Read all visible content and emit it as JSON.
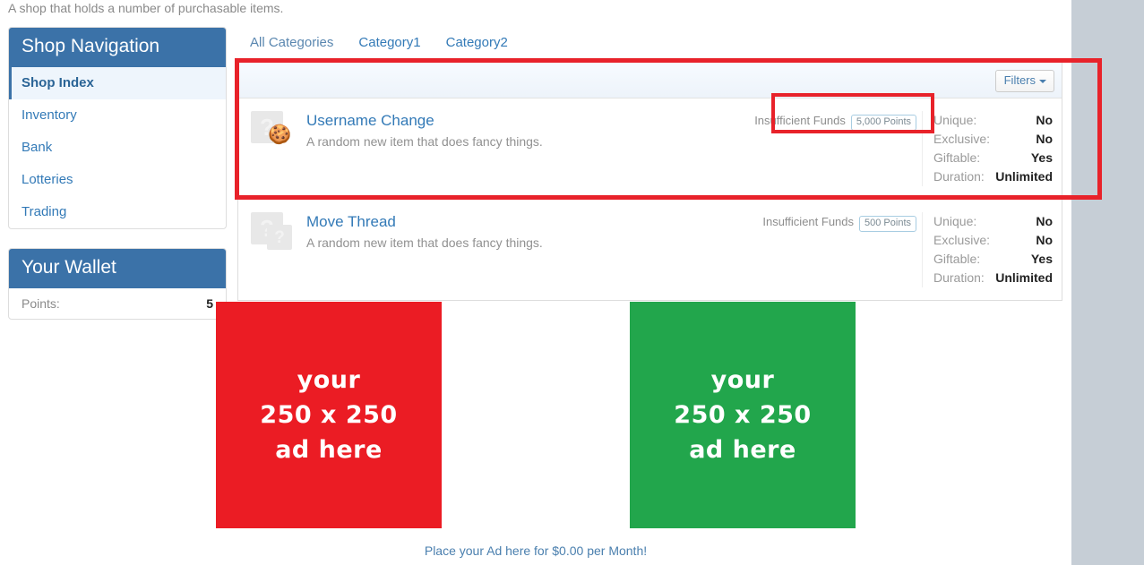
{
  "intro": "A shop that holds a number of purchasable items.",
  "sidebar": {
    "nav": {
      "title": "Shop Navigation",
      "items": [
        {
          "label": "Shop Index",
          "active": true
        },
        {
          "label": "Inventory",
          "active": false
        },
        {
          "label": "Bank",
          "active": false
        },
        {
          "label": "Lotteries",
          "active": false
        },
        {
          "label": "Trading",
          "active": false
        }
      ]
    },
    "wallet": {
      "title": "Your Wallet",
      "points_label": "Points:",
      "points_value": "5"
    }
  },
  "main": {
    "tabs": [
      {
        "label": "All Categories",
        "active": true
      },
      {
        "label": "Category1",
        "active": false
      },
      {
        "label": "Category2",
        "active": false
      }
    ],
    "toolbar": {
      "filters_label": "Filters"
    },
    "items": [
      {
        "title": "Username Change",
        "description": "A random new item that does fancy things.",
        "buy_status": "Insufficient Funds",
        "price_badge": "5,000 Points",
        "thumb_glyph": "?",
        "thumb_style": "cupcake",
        "attributes": [
          {
            "key": "Unique:",
            "value": "No"
          },
          {
            "key": "Exclusive:",
            "value": "No"
          },
          {
            "key": "Giftable:",
            "value": "Yes"
          },
          {
            "key": "Duration:",
            "value": "Unlimited"
          }
        ]
      },
      {
        "title": "Move Thread",
        "description": "A random new item that does fancy things.",
        "buy_status": "Insufficient Funds",
        "price_badge": "500 Points",
        "thumb_glyph": "?",
        "thumb_style": "double",
        "attributes": [
          {
            "key": "Unique:",
            "value": "No"
          },
          {
            "key": "Exclusive:",
            "value": "No"
          },
          {
            "key": "Giftable:",
            "value": "Yes"
          },
          {
            "key": "Duration:",
            "value": "Unlimited"
          }
        ]
      }
    ]
  },
  "ads": {
    "left": {
      "line1": "your",
      "line2": "250 x 250",
      "line3": "ad here",
      "color": "#eb1c24"
    },
    "right": {
      "line1": "your",
      "line2": "250 x 250",
      "line3": "ad here",
      "color": "#22a64c"
    },
    "link": "Place your Ad here for $0.00 per Month!"
  },
  "annotations": {
    "accent_color": "#e8222a",
    "outer_label": "first-item-row-highlight",
    "inner_label": "insufficient-funds-price-highlight"
  }
}
